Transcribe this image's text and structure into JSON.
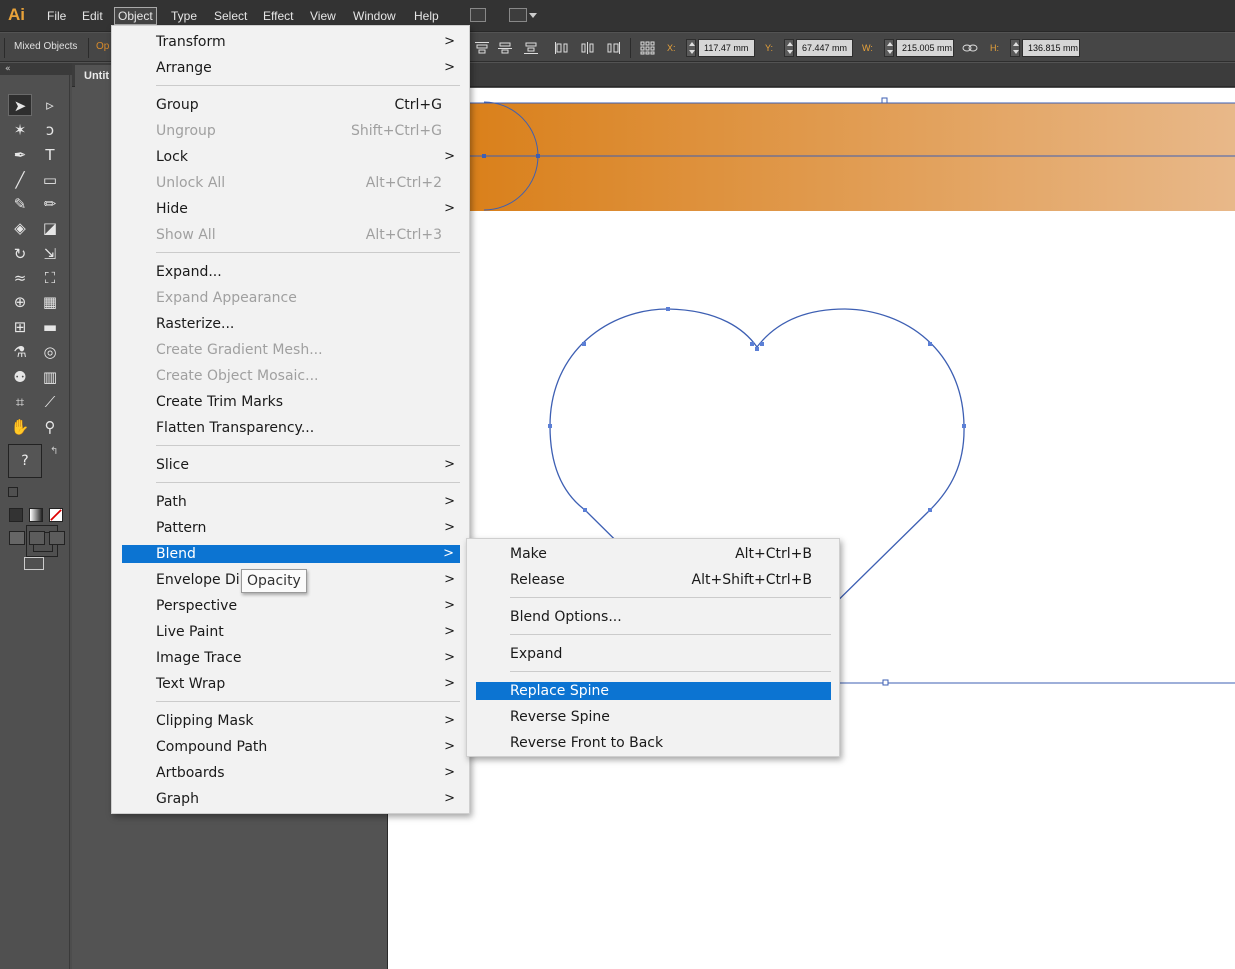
{
  "app": {
    "logo": "Ai"
  },
  "menubar": {
    "items": [
      "File",
      "Edit",
      "Object",
      "Type",
      "Select",
      "Effect",
      "View",
      "Window",
      "Help"
    ],
    "active": "Object"
  },
  "controlbar": {
    "selection_label": "Mixed Objects",
    "opacity_label_partial": "Op",
    "x_label": "X:",
    "x_value": "117.47 mm",
    "y_label": "Y:",
    "y_value": "67.447 mm",
    "w_label": "W:",
    "w_value": "215.005 mm",
    "h_label": "H:",
    "h_value": "136.815 mm"
  },
  "document": {
    "tab_title": "Untit"
  },
  "tools": {
    "fill_label": "?",
    "icons": [
      "selection-tool",
      "direct-selection-tool",
      "magic-wand-tool",
      "lasso-tool",
      "pen-tool",
      "type-tool",
      "line-tool",
      "rectangle-tool",
      "paintbrush-tool",
      "pencil-tool",
      "blob-brush-tool",
      "eraser-tool",
      "rotate-tool",
      "scale-tool",
      "warp-tool",
      "free-transform-tool",
      "shape-builder-tool",
      "perspective-grid-tool",
      "mesh-tool",
      "gradient-tool",
      "eyedropper-tool",
      "blend-tool",
      "symbol-sprayer-tool",
      "column-graph-tool",
      "artboard-tool",
      "slice-tool",
      "hand-tool",
      "zoom-tool"
    ]
  },
  "object_menu": {
    "items": [
      {
        "label": "Transform",
        "submenu": true
      },
      {
        "label": "Arrange",
        "submenu": true
      },
      {
        "label": "Group",
        "shortcut": "Ctrl+G"
      },
      {
        "label": "Ungroup",
        "shortcut": "Shift+Ctrl+G",
        "disabled": true
      },
      {
        "label": "Lock",
        "submenu": true
      },
      {
        "label": "Unlock All",
        "shortcut": "Alt+Ctrl+2",
        "disabled": true
      },
      {
        "label": "Hide",
        "submenu": true
      },
      {
        "label": "Show All",
        "shortcut": "Alt+Ctrl+3",
        "disabled": true
      },
      {
        "label": "Expand..."
      },
      {
        "label": "Expand Appearance",
        "disabled": true
      },
      {
        "label": "Rasterize..."
      },
      {
        "label": "Create Gradient Mesh...",
        "disabled": true
      },
      {
        "label": "Create Object Mosaic...",
        "disabled": true
      },
      {
        "label": "Create Trim Marks"
      },
      {
        "label": "Flatten Transparency..."
      },
      {
        "label": "Slice",
        "submenu": true
      },
      {
        "label": "Path",
        "submenu": true
      },
      {
        "label": "Pattern",
        "submenu": true
      },
      {
        "label": "Blend",
        "submenu": true,
        "highlighted": true
      },
      {
        "label": "Envelope Di",
        "submenu": true
      },
      {
        "label": "Perspective",
        "submenu": true
      },
      {
        "label": "Live Paint",
        "submenu": true
      },
      {
        "label": "Image Trace",
        "submenu": true
      },
      {
        "label": "Text Wrap",
        "submenu": true
      },
      {
        "label": "Clipping Mask",
        "submenu": true
      },
      {
        "label": "Compound Path",
        "submenu": true
      },
      {
        "label": "Artboards",
        "submenu": true
      },
      {
        "label": "Graph",
        "submenu": true
      }
    ]
  },
  "blend_submenu": {
    "items": [
      {
        "label": "Make",
        "shortcut": "Alt+Ctrl+B"
      },
      {
        "label": "Release",
        "shortcut": "Alt+Shift+Ctrl+B"
      },
      {
        "label": "Blend Options..."
      },
      {
        "label": "Expand"
      },
      {
        "label": "Replace Spine",
        "highlighted": true
      },
      {
        "label": "Reverse Spine"
      },
      {
        "label": "Reverse Front to Back"
      }
    ]
  },
  "tooltip": {
    "text": "Opacity"
  },
  "colors": {
    "menubar_bg": "#333333",
    "accent_blue": "#0c74d2",
    "app_orange": "#e8a23a",
    "gradient_start": "#d87a0f",
    "gradient_end": "#e8b889",
    "path_blue": "#3d5fb3"
  }
}
